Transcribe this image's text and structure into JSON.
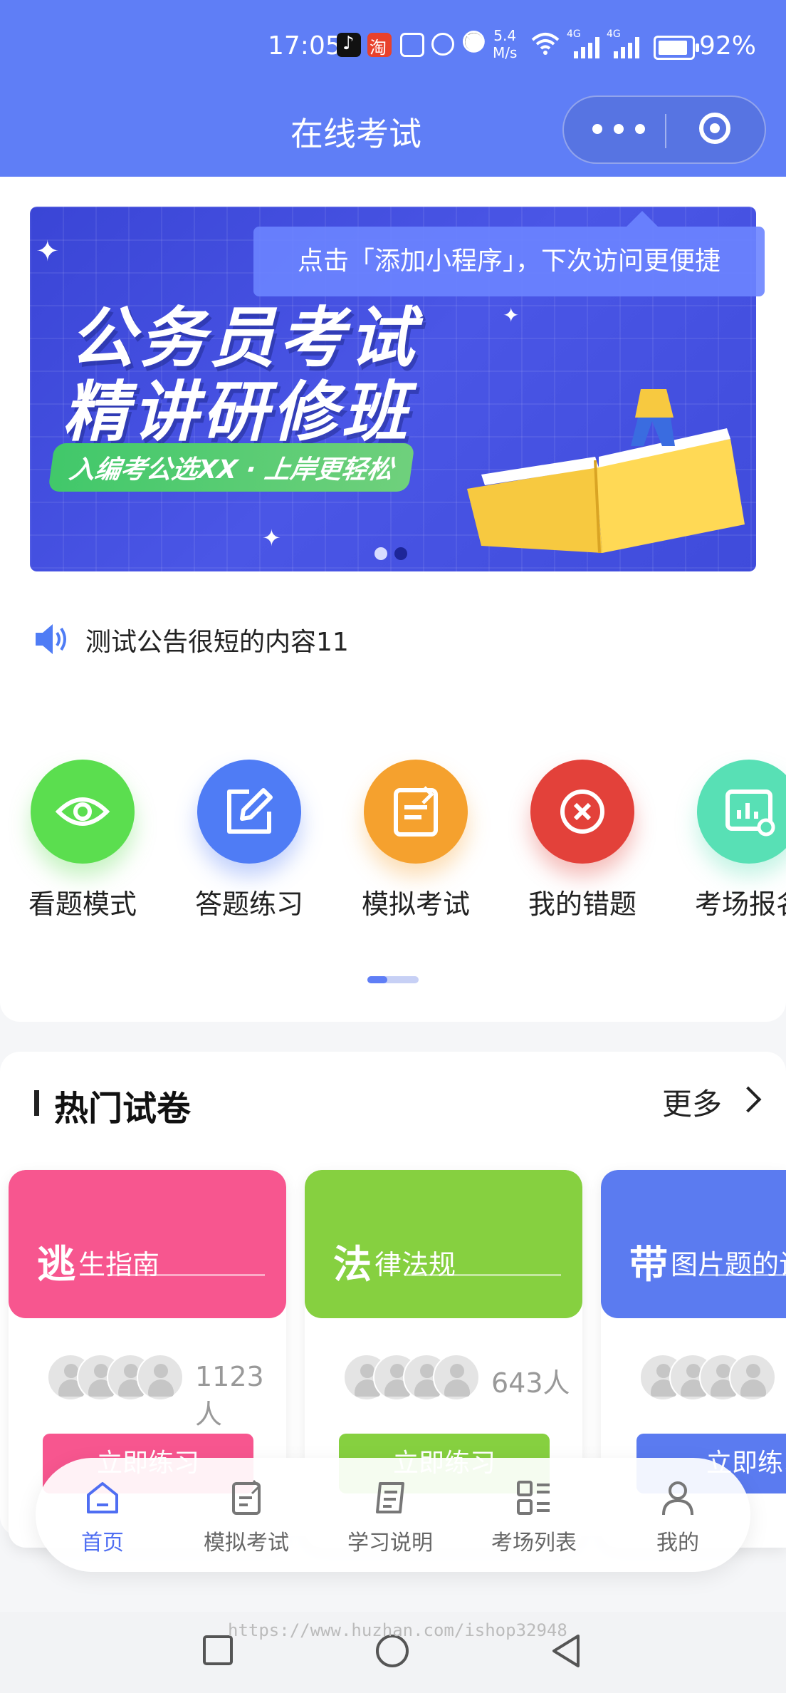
{
  "status_bar": {
    "time": "17:05",
    "net_speed_value": "5.4",
    "net_speed_unit": "M/s",
    "signal1_label": "4G",
    "signal2_label": "4G",
    "battery": "92%",
    "icons": [
      "tiktok-icon",
      "taobao-icon",
      "nfc-icon",
      "alarm-icon",
      "mute-icon",
      "wifi-icon",
      "signal-icon",
      "signal-icon",
      "battery-icon"
    ]
  },
  "nav": {
    "title": "在线考试"
  },
  "banner": {
    "title_line1": "公务员考试",
    "title_line2": "精讲研修班",
    "tagline": "入编考公选XX · 上岸更轻松",
    "slide_count": 2,
    "active_slide": 1
  },
  "tooltip": {
    "text": "点击「添加小程序」，下次访问更便捷"
  },
  "notice": {
    "text": "测试公告很短的内容11"
  },
  "menu": {
    "items": [
      {
        "label": "看题模式",
        "icon": "eye-icon",
        "color": "#5bde4f"
      },
      {
        "label": "答题练习",
        "icon": "edit-icon",
        "color": "#4f7cf5"
      },
      {
        "label": "模拟考试",
        "icon": "exam-icon",
        "color": "#f5a12e"
      },
      {
        "label": "我的错题",
        "icon": "close-circle-icon",
        "color": "#e3413a"
      },
      {
        "label": "考场报名",
        "icon": "chart-icon",
        "color": "#58e0b5"
      }
    ]
  },
  "hot": {
    "title": "热门试卷",
    "more": "更多",
    "papers": [
      {
        "big": "逃",
        "rest": "生指南",
        "count": "1123人",
        "button": "立即练习",
        "color": "#f7568f"
      },
      {
        "big": "法",
        "rest": "律法规",
        "count": "643人",
        "button": "立即练习",
        "color": "#86d040"
      },
      {
        "big": "带",
        "rest": "图片题的试卷",
        "count": "",
        "button": "立即练习",
        "color": "#5b7bf0"
      }
    ]
  },
  "tabbar": {
    "items": [
      {
        "label": "首页",
        "icon": "home-icon",
        "active": true
      },
      {
        "label": "模拟考试",
        "icon": "exam-icon",
        "active": false
      },
      {
        "label": "学习说明",
        "icon": "document-icon",
        "active": false
      },
      {
        "label": "考场列表",
        "icon": "grid-list-icon",
        "active": false
      },
      {
        "label": "我的",
        "icon": "user-icon",
        "active": false
      }
    ],
    "active_color": "#4f6ef2"
  },
  "watermark": "https://www.huzhan.com/ishop32948",
  "colors": {
    "primary": "#5f7ef6",
    "banner_bg": "#4a56e6"
  }
}
